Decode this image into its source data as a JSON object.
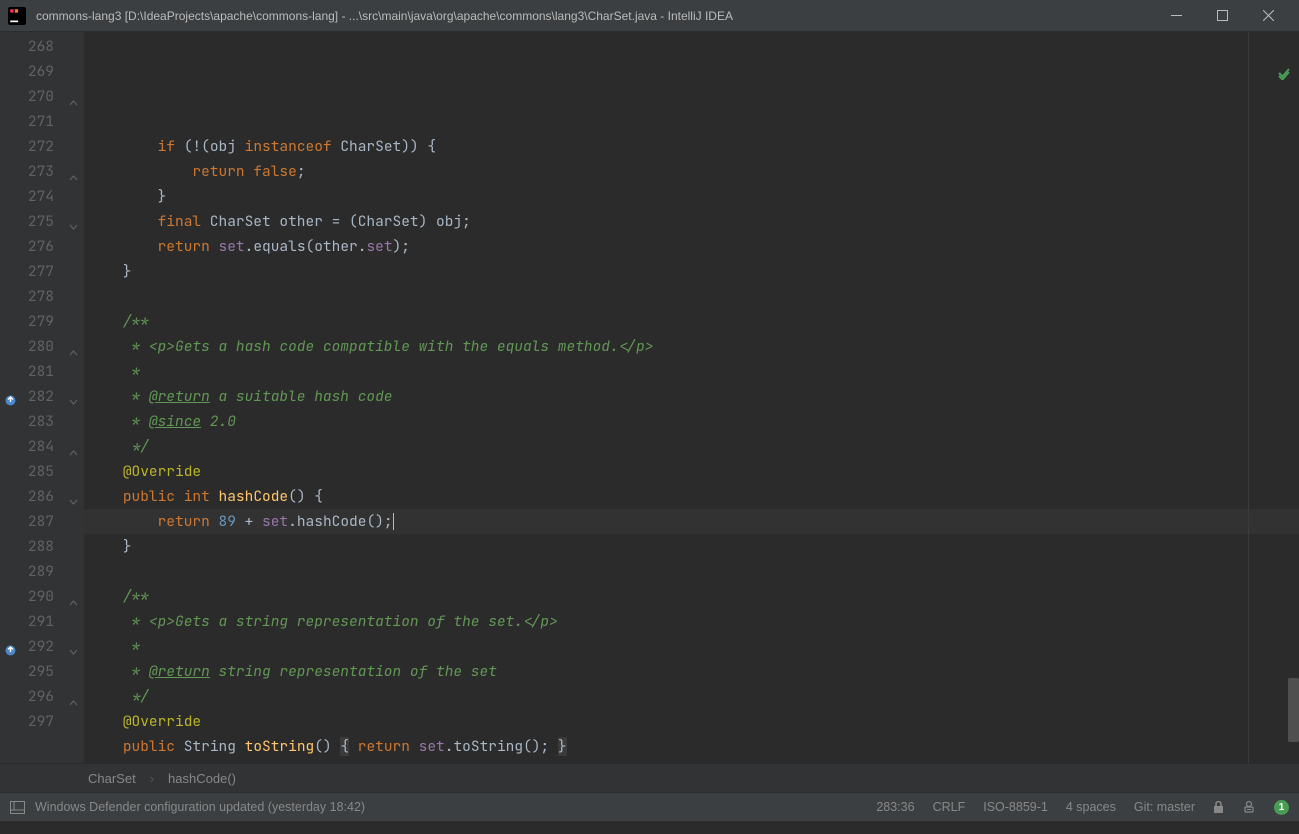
{
  "window": {
    "title": "commons-lang3 [D:\\IdeaProjects\\apache\\commons-lang] - ...\\src\\main\\java\\org\\apache\\commons\\lang3\\CharSet.java - IntelliJ IDEA"
  },
  "lines": [
    {
      "n": "268",
      "t": [
        [
          "w",
          "        "
        ],
        [
          "kw",
          "if"
        ],
        [
          "w",
          " (!(obj "
        ],
        [
          "kw",
          "instanceof"
        ],
        [
          "w",
          " CharSet)) {"
        ]
      ]
    },
    {
      "n": "269",
      "t": [
        [
          "w",
          "            "
        ],
        [
          "kw",
          "return false"
        ],
        [
          "w",
          ";"
        ]
      ]
    },
    {
      "n": "270",
      "t": [
        [
          "w",
          "        }"
        ]
      ],
      "fold": "close"
    },
    {
      "n": "271",
      "t": [
        [
          "w",
          "        "
        ],
        [
          "kw",
          "final"
        ],
        [
          "w",
          " CharSet other = (CharSet) obj;"
        ]
      ]
    },
    {
      "n": "272",
      "t": [
        [
          "w",
          "        "
        ],
        [
          "kw",
          "return"
        ],
        [
          "w",
          " "
        ],
        [
          "purple",
          "set"
        ],
        [
          "w",
          ".equals(other."
        ],
        [
          "purple",
          "set"
        ],
        [
          "w",
          ");"
        ]
      ]
    },
    {
      "n": "273",
      "t": [
        [
          "w",
          "    }"
        ]
      ],
      "fold": "close"
    },
    {
      "n": "274",
      "t": [
        [
          "w",
          ""
        ]
      ]
    },
    {
      "n": "275",
      "t": [
        [
          "w",
          "    "
        ],
        [
          "doc",
          "/**"
        ]
      ],
      "fold": "open"
    },
    {
      "n": "276",
      "t": [
        [
          "w",
          "     "
        ],
        [
          "doc",
          "* <p>Gets a hash code compatible with the equals method.</p>"
        ]
      ]
    },
    {
      "n": "277",
      "t": [
        [
          "w",
          "     "
        ],
        [
          "doc",
          "*"
        ]
      ]
    },
    {
      "n": "278",
      "t": [
        [
          "w",
          "     "
        ],
        [
          "doc",
          "* "
        ],
        [
          "doctag",
          "@return"
        ],
        [
          "doc",
          " a suitable hash code"
        ]
      ]
    },
    {
      "n": "279",
      "t": [
        [
          "w",
          "     "
        ],
        [
          "doc",
          "* "
        ],
        [
          "doctag",
          "@since"
        ],
        [
          "doc",
          " 2.0"
        ]
      ]
    },
    {
      "n": "280",
      "t": [
        [
          "w",
          "     "
        ],
        [
          "doc",
          "*/"
        ]
      ],
      "fold": "close"
    },
    {
      "n": "281",
      "t": [
        [
          "w",
          "    "
        ],
        [
          "ann",
          "@Override"
        ]
      ]
    },
    {
      "n": "282",
      "t": [
        [
          "w",
          "    "
        ],
        [
          "kw",
          "public int "
        ],
        [
          "method",
          "hashCode"
        ],
        [
          "w",
          "() {"
        ]
      ],
      "ovr": true,
      "fold": "open"
    },
    {
      "n": "283",
      "t": [
        [
          "w",
          "        "
        ],
        [
          "kw",
          "return"
        ],
        [
          "w",
          " "
        ],
        [
          "num",
          "89"
        ],
        [
          "w",
          " + "
        ],
        [
          "purple",
          "set"
        ],
        [
          "w",
          ".hashCode();"
        ]
      ],
      "hl": true,
      "caret": true
    },
    {
      "n": "284",
      "t": [
        [
          "w",
          "    }"
        ]
      ],
      "fold": "close"
    },
    {
      "n": "285",
      "t": [
        [
          "w",
          ""
        ]
      ]
    },
    {
      "n": "286",
      "t": [
        [
          "w",
          "    "
        ],
        [
          "doc",
          "/**"
        ]
      ],
      "fold": "open"
    },
    {
      "n": "287",
      "t": [
        [
          "w",
          "     "
        ],
        [
          "doc",
          "* <p>Gets a string representation of the set.</p>"
        ]
      ]
    },
    {
      "n": "288",
      "t": [
        [
          "w",
          "     "
        ],
        [
          "doc",
          "*"
        ]
      ]
    },
    {
      "n": "289",
      "t": [
        [
          "w",
          "     "
        ],
        [
          "doc",
          "* "
        ],
        [
          "doctag",
          "@return"
        ],
        [
          "doc",
          " string representation of the set"
        ]
      ]
    },
    {
      "n": "290",
      "t": [
        [
          "w",
          "     "
        ],
        [
          "doc",
          "*/"
        ]
      ],
      "fold": "close"
    },
    {
      "n": "291",
      "t": [
        [
          "w",
          "    "
        ],
        [
          "ann",
          "@Override"
        ]
      ]
    },
    {
      "n": "292",
      "t": [
        [
          "w",
          "    "
        ],
        [
          "kw",
          "public"
        ],
        [
          "w",
          " String "
        ],
        [
          "method",
          "toString"
        ],
        [
          "w",
          "() "
        ],
        [
          "dimbrace",
          "{"
        ],
        [
          "w",
          " "
        ],
        [
          "kw",
          "return"
        ],
        [
          "w",
          " "
        ],
        [
          "purple",
          "set"
        ],
        [
          "w",
          ".toString(); "
        ],
        [
          "dimbrace",
          "}"
        ]
      ],
      "ovr": true,
      "fold": "open"
    },
    {
      "n": "295",
      "t": [
        [
          "w",
          ""
        ]
      ]
    },
    {
      "n": "296",
      "t": [
        [
          "w",
          "}"
        ]
      ],
      "fold": "close"
    },
    {
      "n": "297",
      "t": [
        [
          "w",
          ""
        ]
      ]
    }
  ],
  "breadcrumbs": {
    "class": "CharSet",
    "method": "hashCode()"
  },
  "status": {
    "message": "Windows Defender configuration updated (yesterday 18:42)",
    "pos": "283:36",
    "eol": "CRLF",
    "enc": "ISO-8859-1",
    "indent": "4 spaces",
    "git": "Git: master",
    "badge": "1"
  }
}
